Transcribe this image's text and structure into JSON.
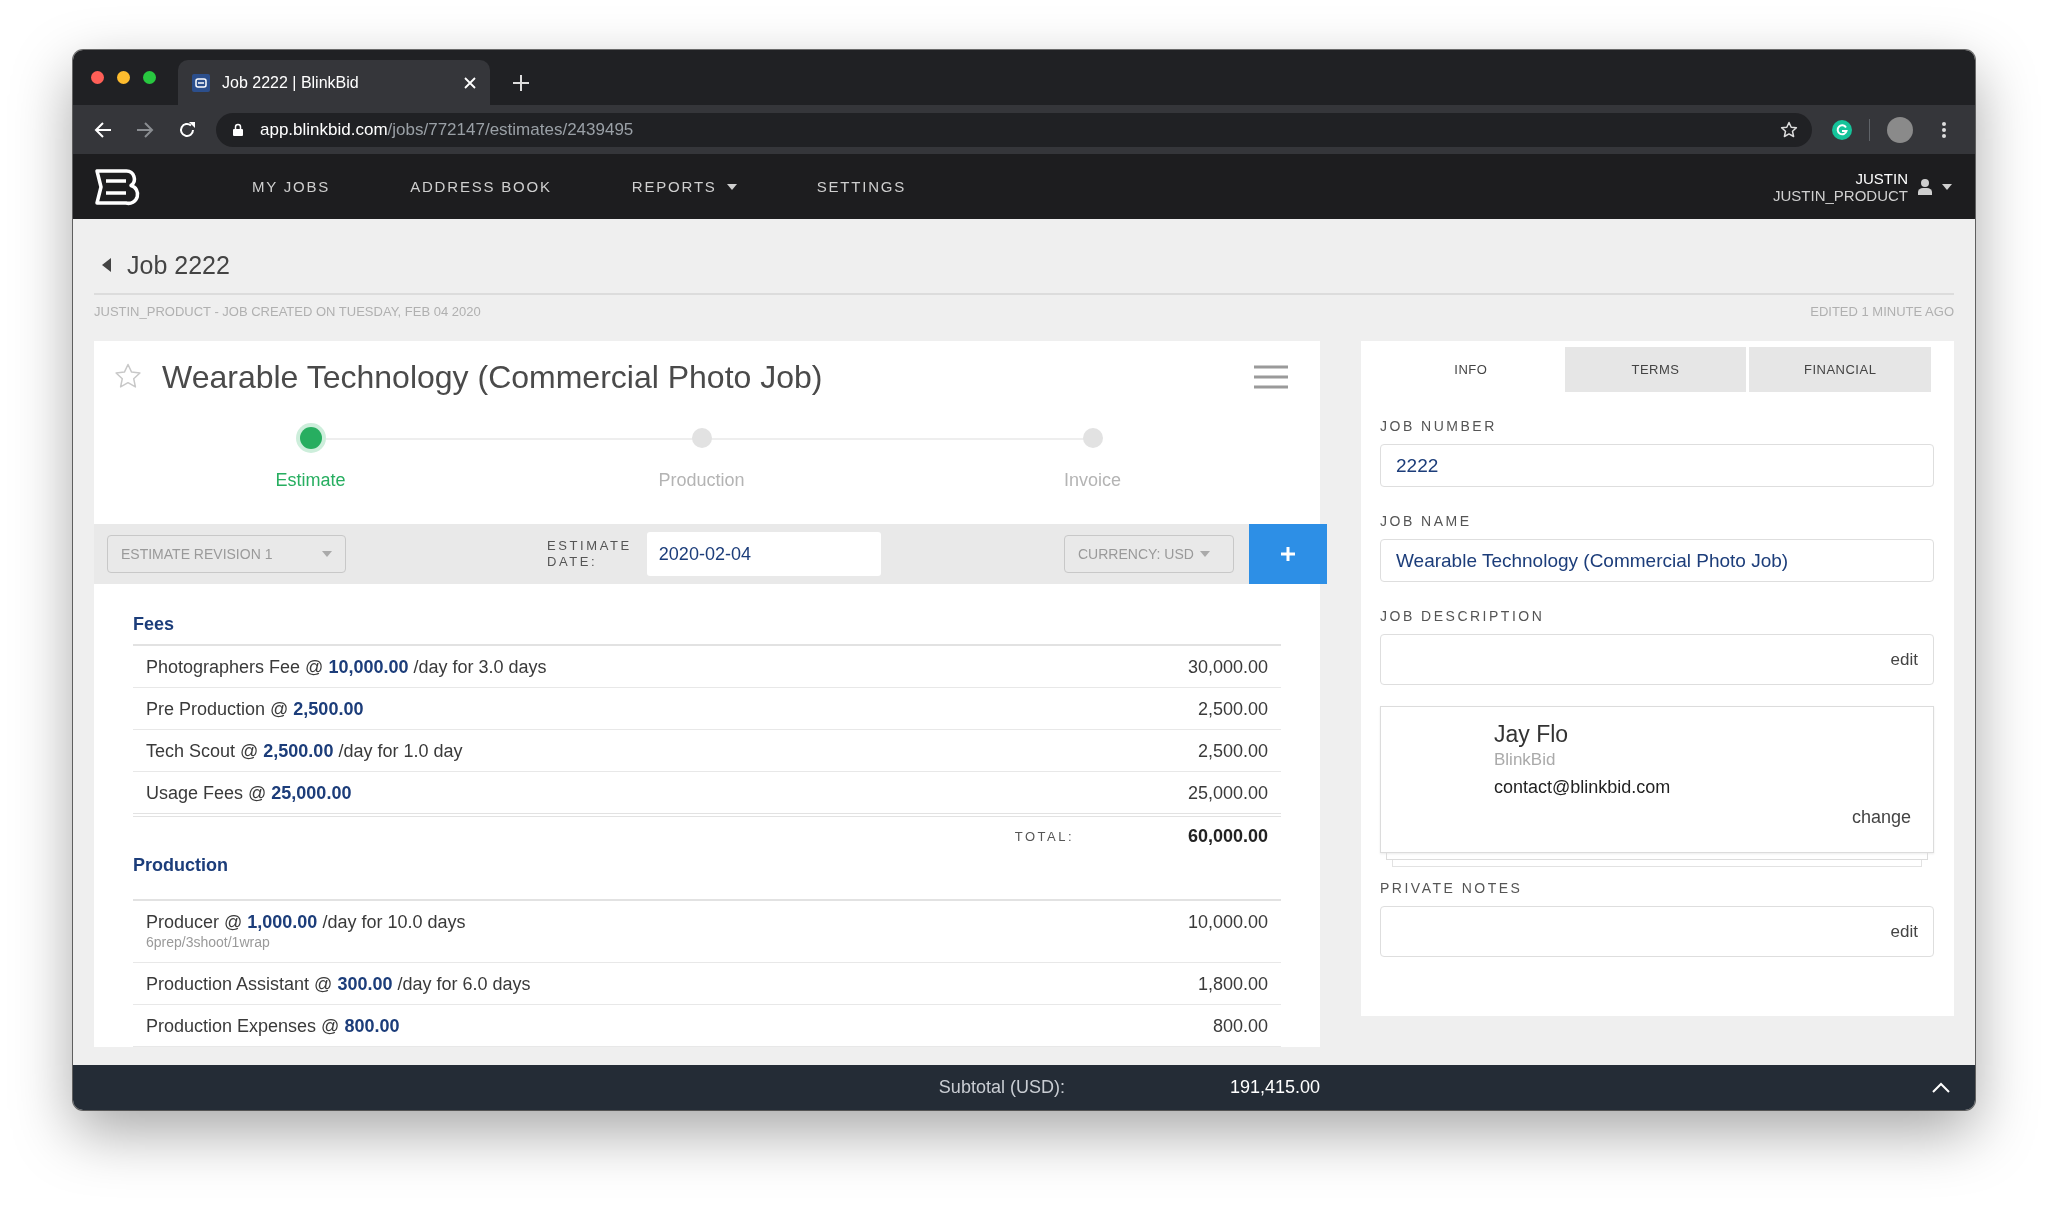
{
  "browser": {
    "tab_title": "Job 2222 | BlinkBid",
    "url_host": "app.blinkbid.com",
    "url_path": "/jobs/772147/estimates/2439495"
  },
  "nav": {
    "items": [
      {
        "label": "MY JOBS",
        "has_menu": false
      },
      {
        "label": "ADDRESS BOOK",
        "has_menu": false
      },
      {
        "label": "REPORTS",
        "has_menu": true
      },
      {
        "label": "SETTINGS",
        "has_menu": false
      }
    ],
    "user": {
      "name": "JUSTIN",
      "account": "JUSTIN_PRODUCT"
    }
  },
  "page": {
    "title": "Job 2222",
    "created_note": "JUSTIN_PRODUCT - JOB CREATED ON TUESDAY, FEB 04 2020",
    "edited_note": "EDITED 1 MINUTE AGO"
  },
  "estimate": {
    "title": "Wearable Technology (Commercial Photo Job)",
    "starred": false,
    "steps": [
      {
        "label": "Estimate",
        "selected": true
      },
      {
        "label": "Production",
        "selected": false
      },
      {
        "label": "Invoice",
        "selected": false
      }
    ],
    "revision": "ESTIMATE REVISION 1",
    "date_label": "ESTIMATE DATE:",
    "date": "2020-02-04",
    "currency": "CURRENCY: USD",
    "sections": [
      {
        "title": "Fees",
        "rows": [
          {
            "text": "Photographers Fee @ **10,000.00** /day for 3.0 days",
            "amount": "30,000.00"
          },
          {
            "text": "Pre Production @ **2,500.00**",
            "amount": "2,500.00"
          },
          {
            "text": "Tech Scout @ **2,500.00** /day for 1.0 day",
            "amount": "2,500.00"
          },
          {
            "text": "Usage Fees @ **25,000.00**",
            "amount": "25,000.00"
          }
        ],
        "total_label": "TOTAL:",
        "total": "60,000.00"
      },
      {
        "title": "Production",
        "rows": [
          {
            "text": "Producer @ **1,000.00** /day for 10.0 days",
            "note": "6prep/3shoot/1wrap",
            "amount": "10,000.00"
          },
          {
            "text": "Production Assistant @ **300.00** /day for 6.0 days",
            "amount": "1,800.00"
          },
          {
            "text": "Production Expenses @ **800.00**",
            "amount": "800.00"
          }
        ]
      }
    ]
  },
  "info_panel": {
    "tabs": [
      {
        "label": "INFO",
        "selected": true
      },
      {
        "label": "TERMS",
        "selected": false
      },
      {
        "label": "FINANCIAL",
        "selected": false
      }
    ],
    "fields": [
      {
        "kind": "input",
        "label": "JOB NUMBER",
        "value": "2222"
      },
      {
        "kind": "input",
        "label": "JOB NAME",
        "value": "Wearable Technology (Commercial Photo Job)"
      },
      {
        "kind": "note",
        "label": "JOB DESCRIPTION",
        "action": "edit"
      },
      {
        "kind": "contact",
        "name": "Jay Flo",
        "company": "BlinkBid",
        "email": "contact@blinkbid.com",
        "action": "change"
      },
      {
        "kind": "note",
        "label": "PRIVATE NOTES",
        "action": "edit"
      }
    ]
  },
  "subtotal": {
    "label": "Subtotal (USD):",
    "value": "191,415.00"
  }
}
